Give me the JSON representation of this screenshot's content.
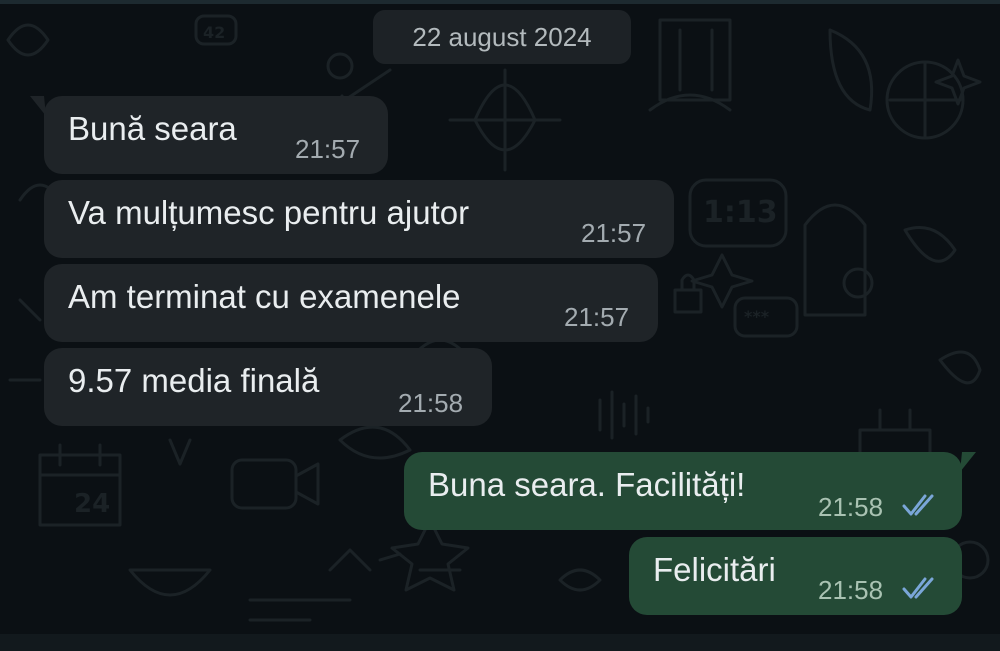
{
  "chat": {
    "date_label": "22 august 2024",
    "messages": [
      {
        "direction": "incoming",
        "text": "Bună seara",
        "time": "21:57"
      },
      {
        "direction": "incoming",
        "text": "Va mulțumesc pentru ajutor",
        "time": "21:57"
      },
      {
        "direction": "incoming",
        "text": "Am terminat cu examenele",
        "time": "21:57"
      },
      {
        "direction": "incoming",
        "text": "9.57 media finală",
        "time": "21:58"
      },
      {
        "direction": "outgoing",
        "text": "Buna seara. Facilități!",
        "time": "21:58",
        "status": "read",
        "status_icon": "double-check-icon"
      },
      {
        "direction": "outgoing",
        "text": "Felicitări",
        "time": "21:58",
        "status": "read",
        "status_icon": "double-check-icon"
      }
    ]
  },
  "colors": {
    "background": "#0b1014",
    "incoming_bubble": "#1f2428",
    "outgoing_bubble": "#244a36",
    "read_ticks": "#7aa6d8"
  }
}
